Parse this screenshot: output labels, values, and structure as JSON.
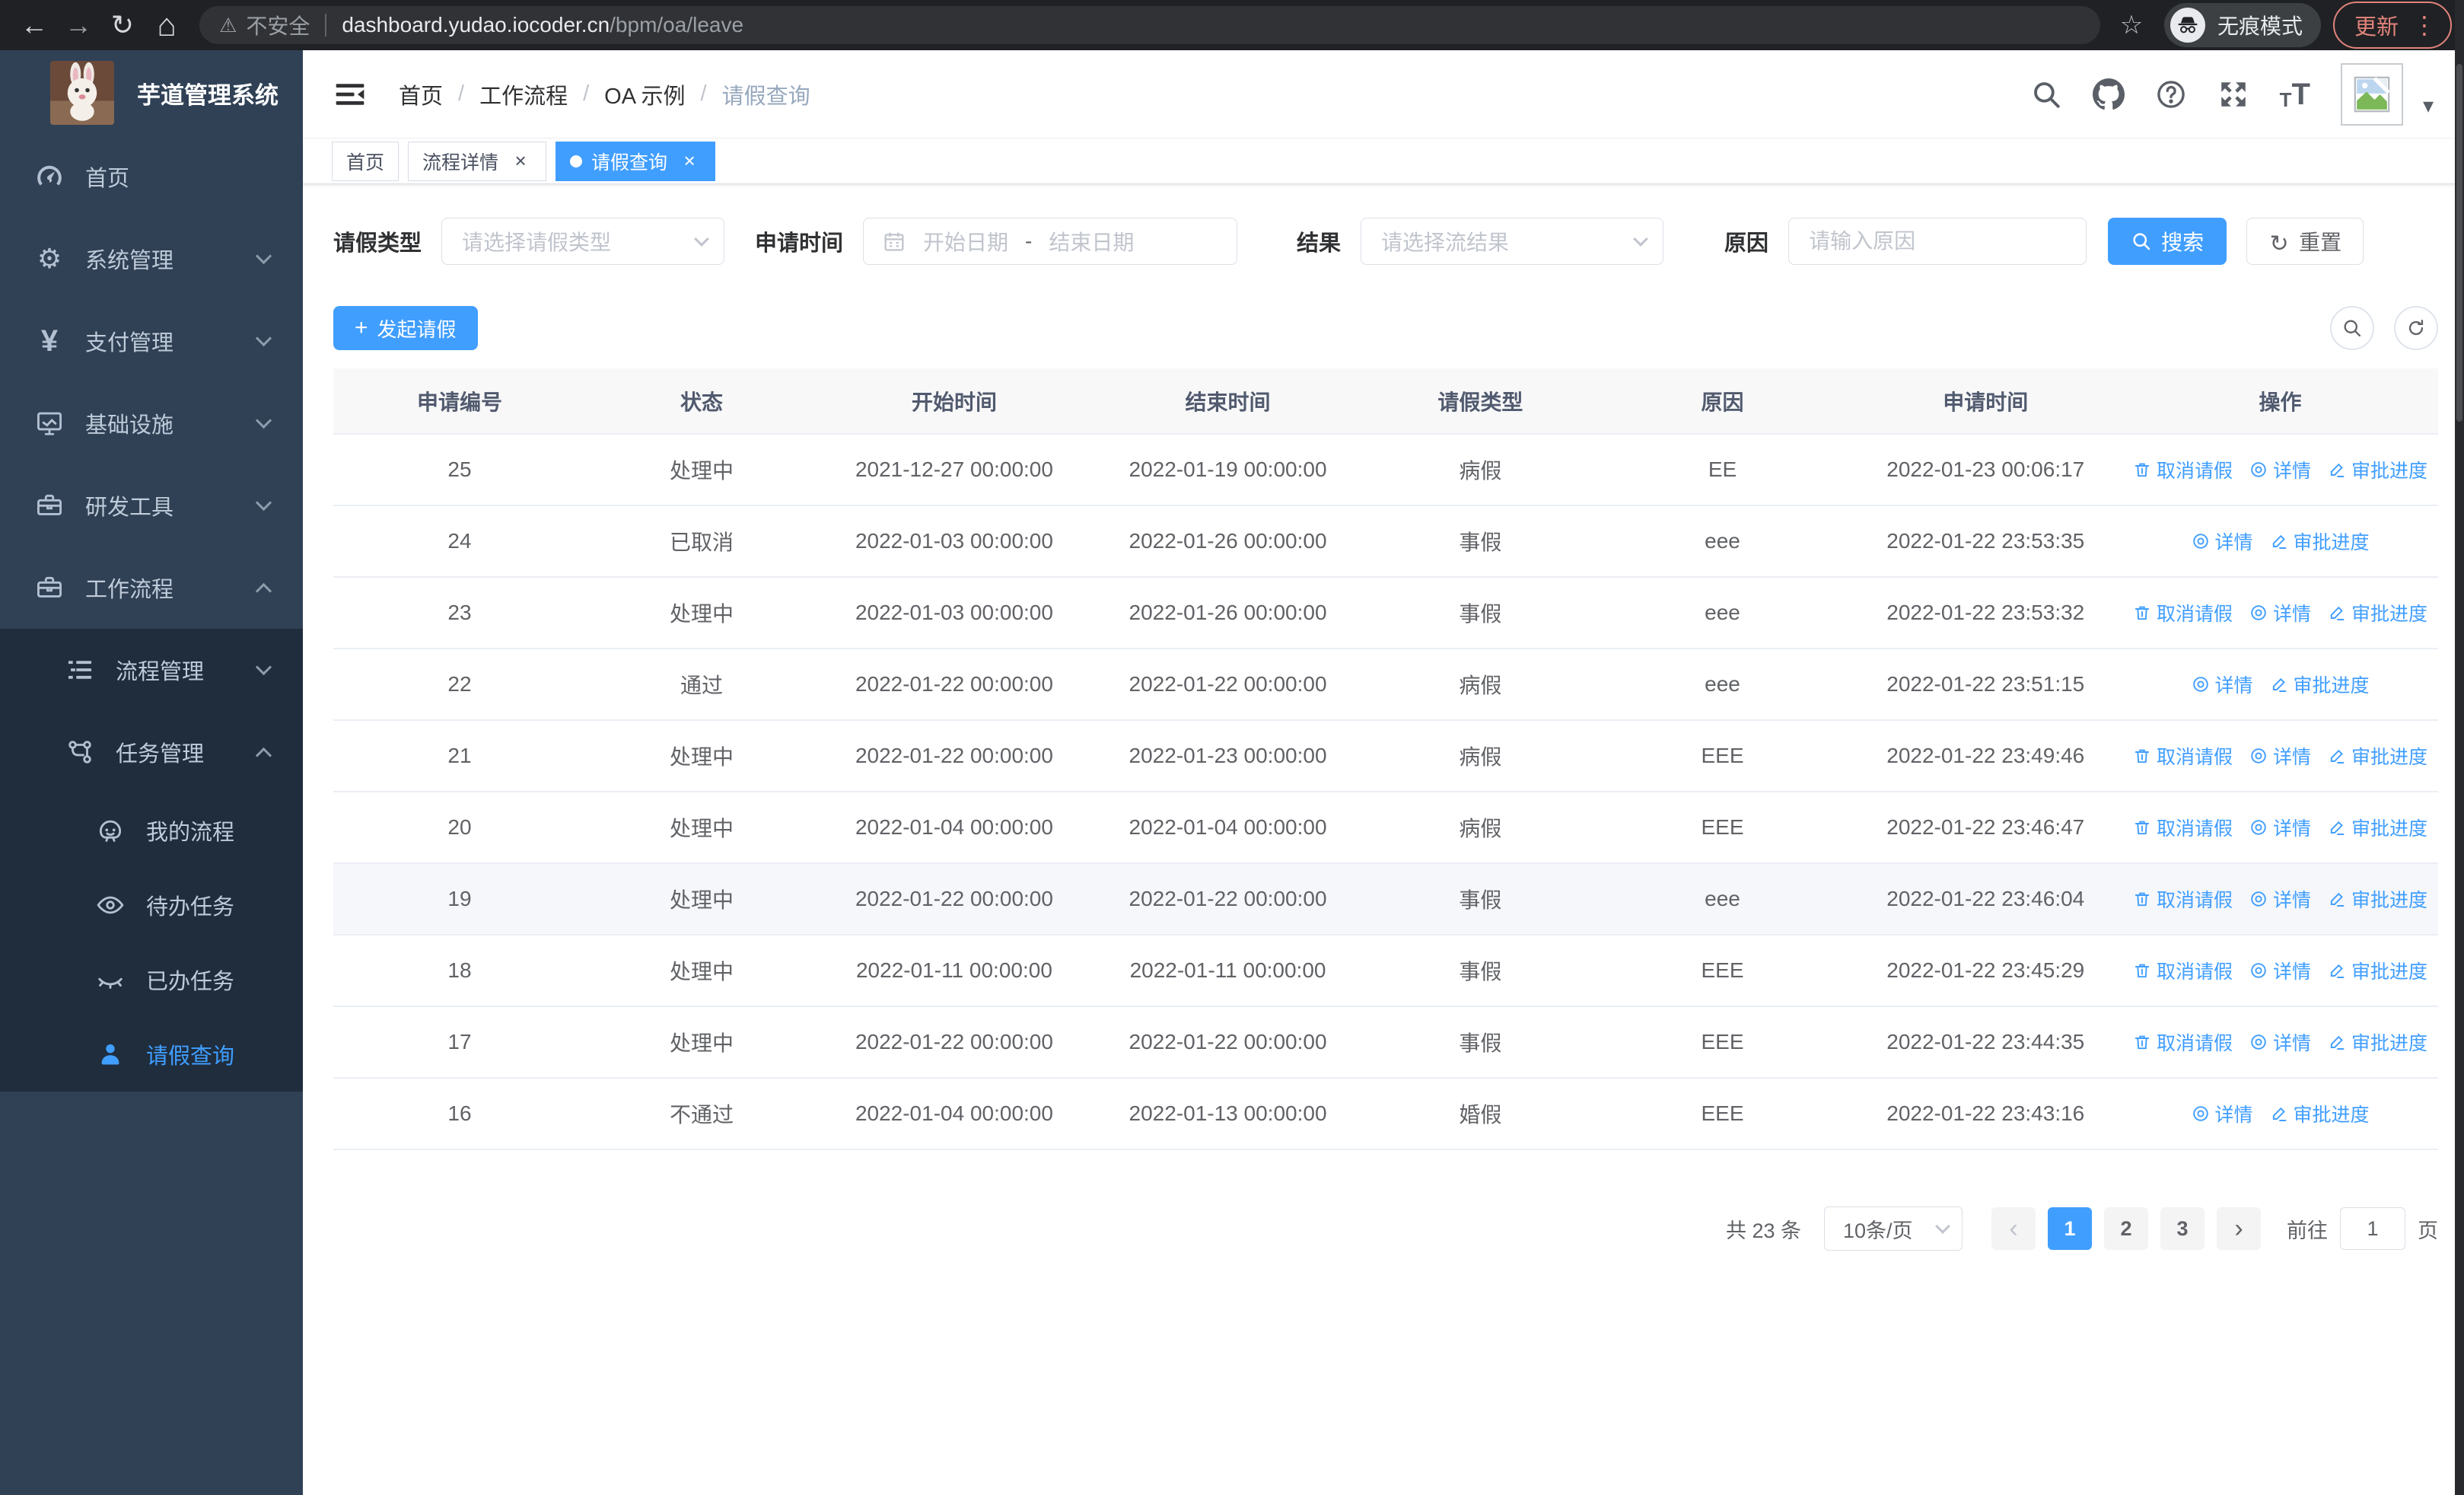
{
  "browser": {
    "security_label": "不安全",
    "url_host": "dashboard.yudao.iocoder.cn",
    "url_path": "/bpm/oa/leave",
    "incognito_label": "无痕模式",
    "update_label": "更新"
  },
  "sidebar": {
    "logo_title": "芋道管理系统",
    "items": [
      {
        "label": "首页",
        "icon": "gauge-icon",
        "level": 1,
        "chevron": null,
        "submenu": false,
        "active": false
      },
      {
        "label": "系统管理",
        "icon": "gear-icon",
        "level": 1,
        "chevron": "down",
        "submenu": false,
        "active": false
      },
      {
        "label": "支付管理",
        "icon": "yen-icon",
        "level": 1,
        "chevron": "down",
        "submenu": false,
        "active": false
      },
      {
        "label": "基础设施",
        "icon": "monitor-icon",
        "level": 1,
        "chevron": "down",
        "submenu": false,
        "active": false
      },
      {
        "label": "研发工具",
        "icon": "toolbox-icon",
        "level": 1,
        "chevron": "down",
        "submenu": false,
        "active": false
      },
      {
        "label": "工作流程",
        "icon": "briefcase-icon",
        "level": 1,
        "chevron": "up",
        "submenu": false,
        "active": false
      },
      {
        "label": "流程管理",
        "icon": "list-tree-icon",
        "level": 2,
        "chevron": "down",
        "submenu": true,
        "active": false
      },
      {
        "label": "任务管理",
        "icon": "share-nodes-icon",
        "level": 2,
        "chevron": "up",
        "submenu": true,
        "active": false
      },
      {
        "label": "我的流程",
        "icon": "robot-icon",
        "level": 3,
        "chevron": null,
        "submenu": true,
        "active": false
      },
      {
        "label": "待办任务",
        "icon": "eye-open-icon",
        "level": 3,
        "chevron": null,
        "submenu": true,
        "active": false
      },
      {
        "label": "已办任务",
        "icon": "eye-closed-icon",
        "level": 3,
        "chevron": null,
        "submenu": true,
        "active": false
      },
      {
        "label": "请假查询",
        "icon": "person-icon",
        "level": 3,
        "chevron": null,
        "submenu": true,
        "active": true
      }
    ]
  },
  "header": {
    "breadcrumb": [
      {
        "label": "首页",
        "muted": false
      },
      {
        "label": "工作流程",
        "muted": false
      },
      {
        "label": "OA 示例",
        "muted": false
      },
      {
        "label": "请假查询",
        "muted": true
      }
    ],
    "breadcrumb_separator": "/"
  },
  "tabs": [
    {
      "label": "首页",
      "active": false,
      "closable": false
    },
    {
      "label": "流程详情",
      "active": false,
      "closable": true
    },
    {
      "label": "请假查询",
      "active": true,
      "closable": true
    }
  ],
  "filters": {
    "leave_type_label": "请假类型",
    "leave_type_placeholder": "请选择请假类型",
    "apply_time_label": "申请时间",
    "date_start_placeholder": "开始日期",
    "date_separator": "-",
    "date_end_placeholder": "结束日期",
    "result_label": "结果",
    "result_placeholder": "请选择流结果",
    "reason_label": "原因",
    "reason_placeholder": "请输入原因",
    "search_label": "搜索",
    "reset_label": "重置"
  },
  "toolbar": {
    "create_label": "发起请假"
  },
  "table": {
    "columns": [
      "申请编号",
      "状态",
      "开始时间",
      "结束时间",
      "请假类型",
      "原因",
      "申请时间",
      "操作"
    ],
    "action_defs": {
      "cancel": {
        "label": "取消请假",
        "icon": "trash-icon"
      },
      "detail": {
        "label": "详情",
        "icon": "view-icon"
      },
      "progress": {
        "label": "审批进度",
        "icon": "edit-icon"
      }
    },
    "rows": [
      {
        "id": "25",
        "status": "处理中",
        "start": "2021-12-27 00:00:00",
        "end": "2022-01-19 00:00:00",
        "type": "病假",
        "reason": "EE",
        "applied": "2022-01-23 00:06:17",
        "actions": [
          "cancel",
          "detail",
          "progress"
        ],
        "hover": false
      },
      {
        "id": "24",
        "status": "已取消",
        "start": "2022-01-03 00:00:00",
        "end": "2022-01-26 00:00:00",
        "type": "事假",
        "reason": "eee",
        "applied": "2022-01-22 23:53:35",
        "actions": [
          "detail",
          "progress"
        ],
        "hover": false
      },
      {
        "id": "23",
        "status": "处理中",
        "start": "2022-01-03 00:00:00",
        "end": "2022-01-26 00:00:00",
        "type": "事假",
        "reason": "eee",
        "applied": "2022-01-22 23:53:32",
        "actions": [
          "cancel",
          "detail",
          "progress"
        ],
        "hover": false
      },
      {
        "id": "22",
        "status": "通过",
        "start": "2022-01-22 00:00:00",
        "end": "2022-01-22 00:00:00",
        "type": "病假",
        "reason": "eee",
        "applied": "2022-01-22 23:51:15",
        "actions": [
          "detail",
          "progress"
        ],
        "hover": false
      },
      {
        "id": "21",
        "status": "处理中",
        "start": "2022-01-22 00:00:00",
        "end": "2022-01-23 00:00:00",
        "type": "病假",
        "reason": "EEE",
        "applied": "2022-01-22 23:49:46",
        "actions": [
          "cancel",
          "detail",
          "progress"
        ],
        "hover": false
      },
      {
        "id": "20",
        "status": "处理中",
        "start": "2022-01-04 00:00:00",
        "end": "2022-01-04 00:00:00",
        "type": "病假",
        "reason": "EEE",
        "applied": "2022-01-22 23:46:47",
        "actions": [
          "cancel",
          "detail",
          "progress"
        ],
        "hover": false
      },
      {
        "id": "19",
        "status": "处理中",
        "start": "2022-01-22 00:00:00",
        "end": "2022-01-22 00:00:00",
        "type": "事假",
        "reason": "eee",
        "applied": "2022-01-22 23:46:04",
        "actions": [
          "cancel",
          "detail",
          "progress"
        ],
        "hover": true
      },
      {
        "id": "18",
        "status": "处理中",
        "start": "2022-01-11 00:00:00",
        "end": "2022-01-11 00:00:00",
        "type": "事假",
        "reason": "EEE",
        "applied": "2022-01-22 23:45:29",
        "actions": [
          "cancel",
          "detail",
          "progress"
        ],
        "hover": false
      },
      {
        "id": "17",
        "status": "处理中",
        "start": "2022-01-22 00:00:00",
        "end": "2022-01-22 00:00:00",
        "type": "事假",
        "reason": "EEE",
        "applied": "2022-01-22 23:44:35",
        "actions": [
          "cancel",
          "detail",
          "progress"
        ],
        "hover": false
      },
      {
        "id": "16",
        "status": "不通过",
        "start": "2022-01-04 00:00:00",
        "end": "2022-01-13 00:00:00",
        "type": "婚假",
        "reason": "EEE",
        "applied": "2022-01-22 23:43:16",
        "actions": [
          "detail",
          "progress"
        ],
        "hover": false
      }
    ]
  },
  "pagination": {
    "total_label": "共 23 条",
    "page_size": "10条/页",
    "pages": [
      "1",
      "2",
      "3"
    ],
    "active_page": "1",
    "goto_label": "前往",
    "goto_value": "1",
    "page_suffix": "页"
  }
}
